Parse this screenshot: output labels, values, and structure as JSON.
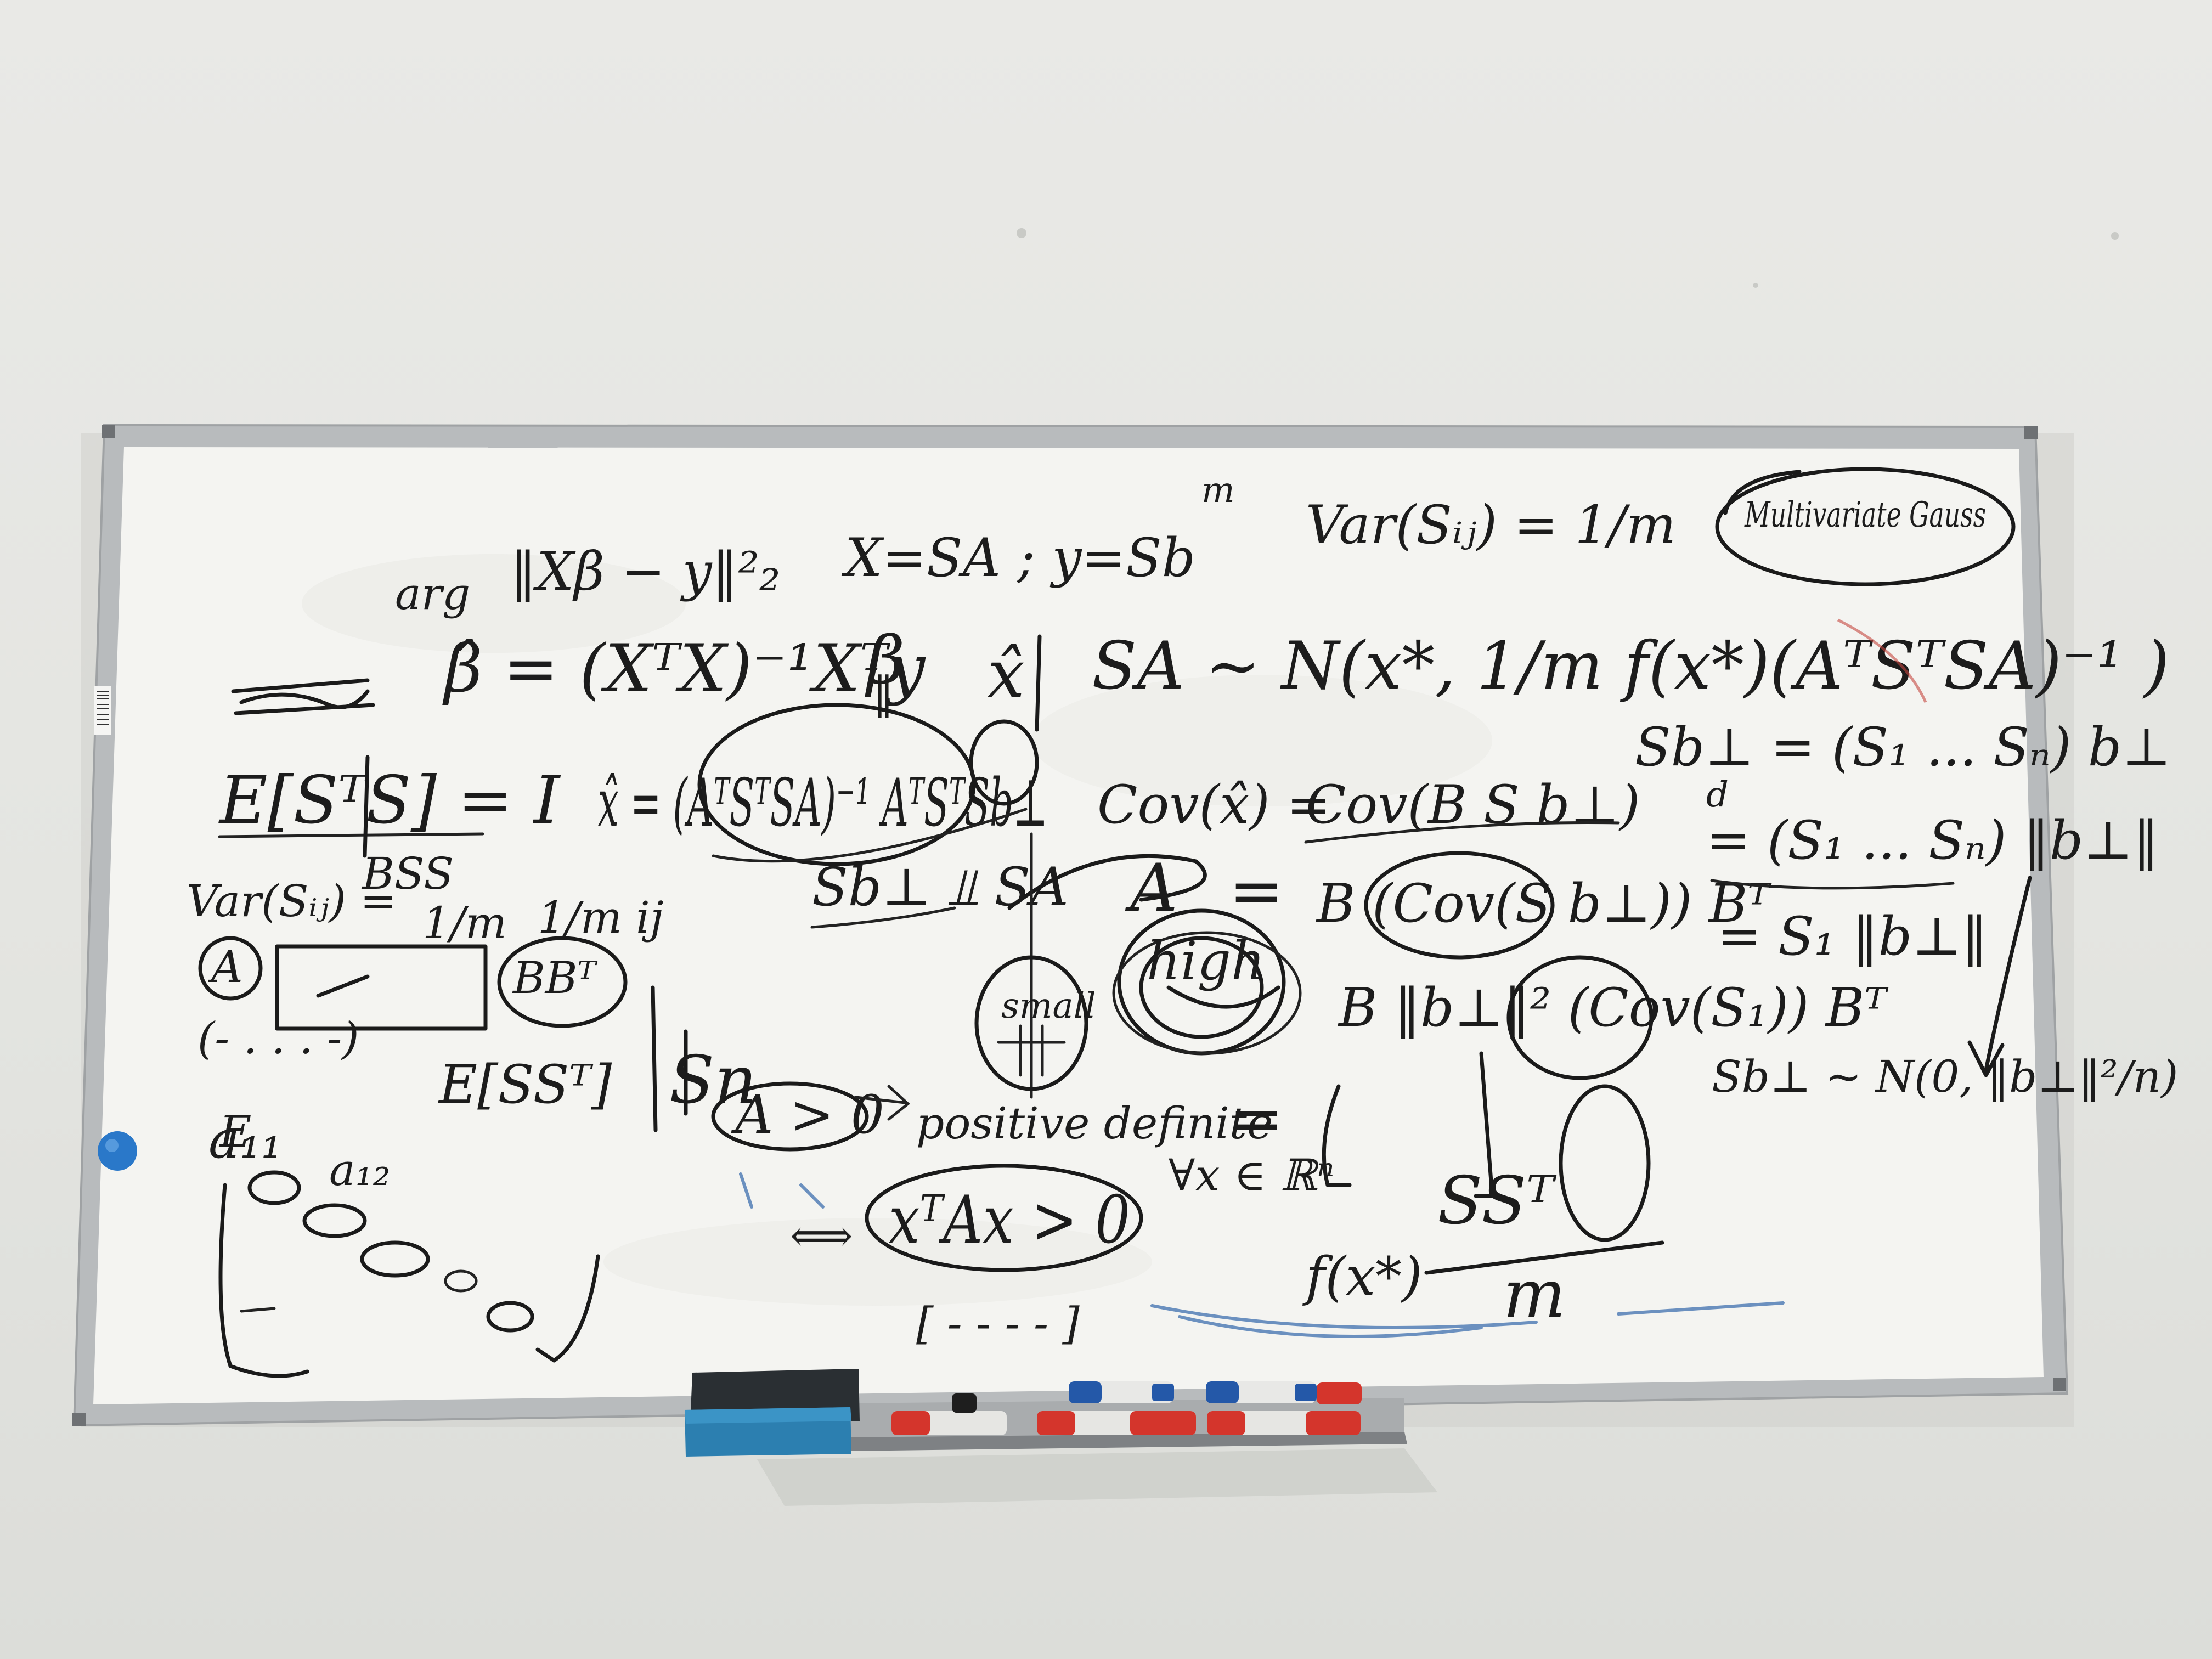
{
  "scene": {
    "type": "photo of whiteboard on a wall",
    "colors": {
      "wall": "#e6e7e3",
      "board": "#f4f4f1",
      "frame": "#b9bcbf",
      "ink": "#1c1c1c",
      "eraser_felt": "#2a2f33",
      "eraser_body": "#2c7fb0",
      "magnet": "#2a78c9",
      "marker_red": "#d4352c",
      "marker_blue": "#2458a8"
    }
  },
  "board": {
    "math": {
      "argmin": "arg",
      "least_squares": "‖Xβ − y‖²₂",
      "sketch_assign": "X=SA ;  y=Sb",
      "var_header": "Var(Sᵢⱼ) = 1/m",
      "var_m_note": "m",
      "beta_hat": "β̂ = (XᵀX)⁻¹Xᵀy",
      "beta_eq": "β",
      "beta_eq_mark": "‖",
      "x_hat": "x̂",
      "dist": "SA ~ N(x*, 1/m f(x*)(AᵀSᵀSA)⁻¹ )",
      "x_hat_formula": "x̂ = (AᵀSᵀSA)⁻¹ AᵀSᵀSb⊥",
      "cov_lhs": "Cov(x̂) =",
      "cov_rhs": "Cov(B S b⊥)",
      "cov_eq2_lhs": "=",
      "cov_eq2": "B (Cov(S b⊥)) Bᵀ",
      "cov_eq3": "B ‖b⊥‖² (Cov(S₁)) Bᵀ",
      "indep": "Sb⊥ ⫫ SA",
      "a_letter": "A",
      "a_eq": "=",
      "high": "high",
      "small": "small",
      "expectation": "E[SᵀS] = I",
      "var_s": "Var(Sᵢⱼ) =",
      "var_s_frac": "1/m",
      "one_over_m_ij": "1/m  ij",
      "a_circled": "A",
      "bbt": "BBᵀ",
      "e_ss": "E[SSᵀ]",
      "s_n": "Sn",
      "a_pd": "A > 0",
      "positive_definite": "positive definite",
      "equals_bracket": "=",
      "forall": "∀x ∈ ℝⁿ",
      "xtax": "xᵀAx > 0",
      "iff": "⟺",
      "f_xstar": "f(x*)",
      "sst": "SSᵀ",
      "sst_den": "m",
      "sb_def": "Sb⊥ = (S₁ ... Sₙ) b⊥",
      "sb_def2": "= (S₁ ... Sₙ) ‖b⊥‖",
      "sb_def3": "= S₁ ‖b⊥‖",
      "sb_dist": "Sb⊥ ~ N(0, ‖b⊥‖²/n)",
      "a11": "a₁₁",
      "a12": "a₁₂",
      "matrix_e": "E",
      "dist_over": "d",
      "dots": "(- . . . -)",
      "dots2": "[ - - - - ]"
    },
    "multivariate_label": "Multivariate Gauss"
  },
  "tray": {
    "items": [
      "eraser",
      "marker",
      "marker",
      "marker",
      "marker",
      "marker",
      "marker",
      "marker",
      "marker"
    ]
  }
}
